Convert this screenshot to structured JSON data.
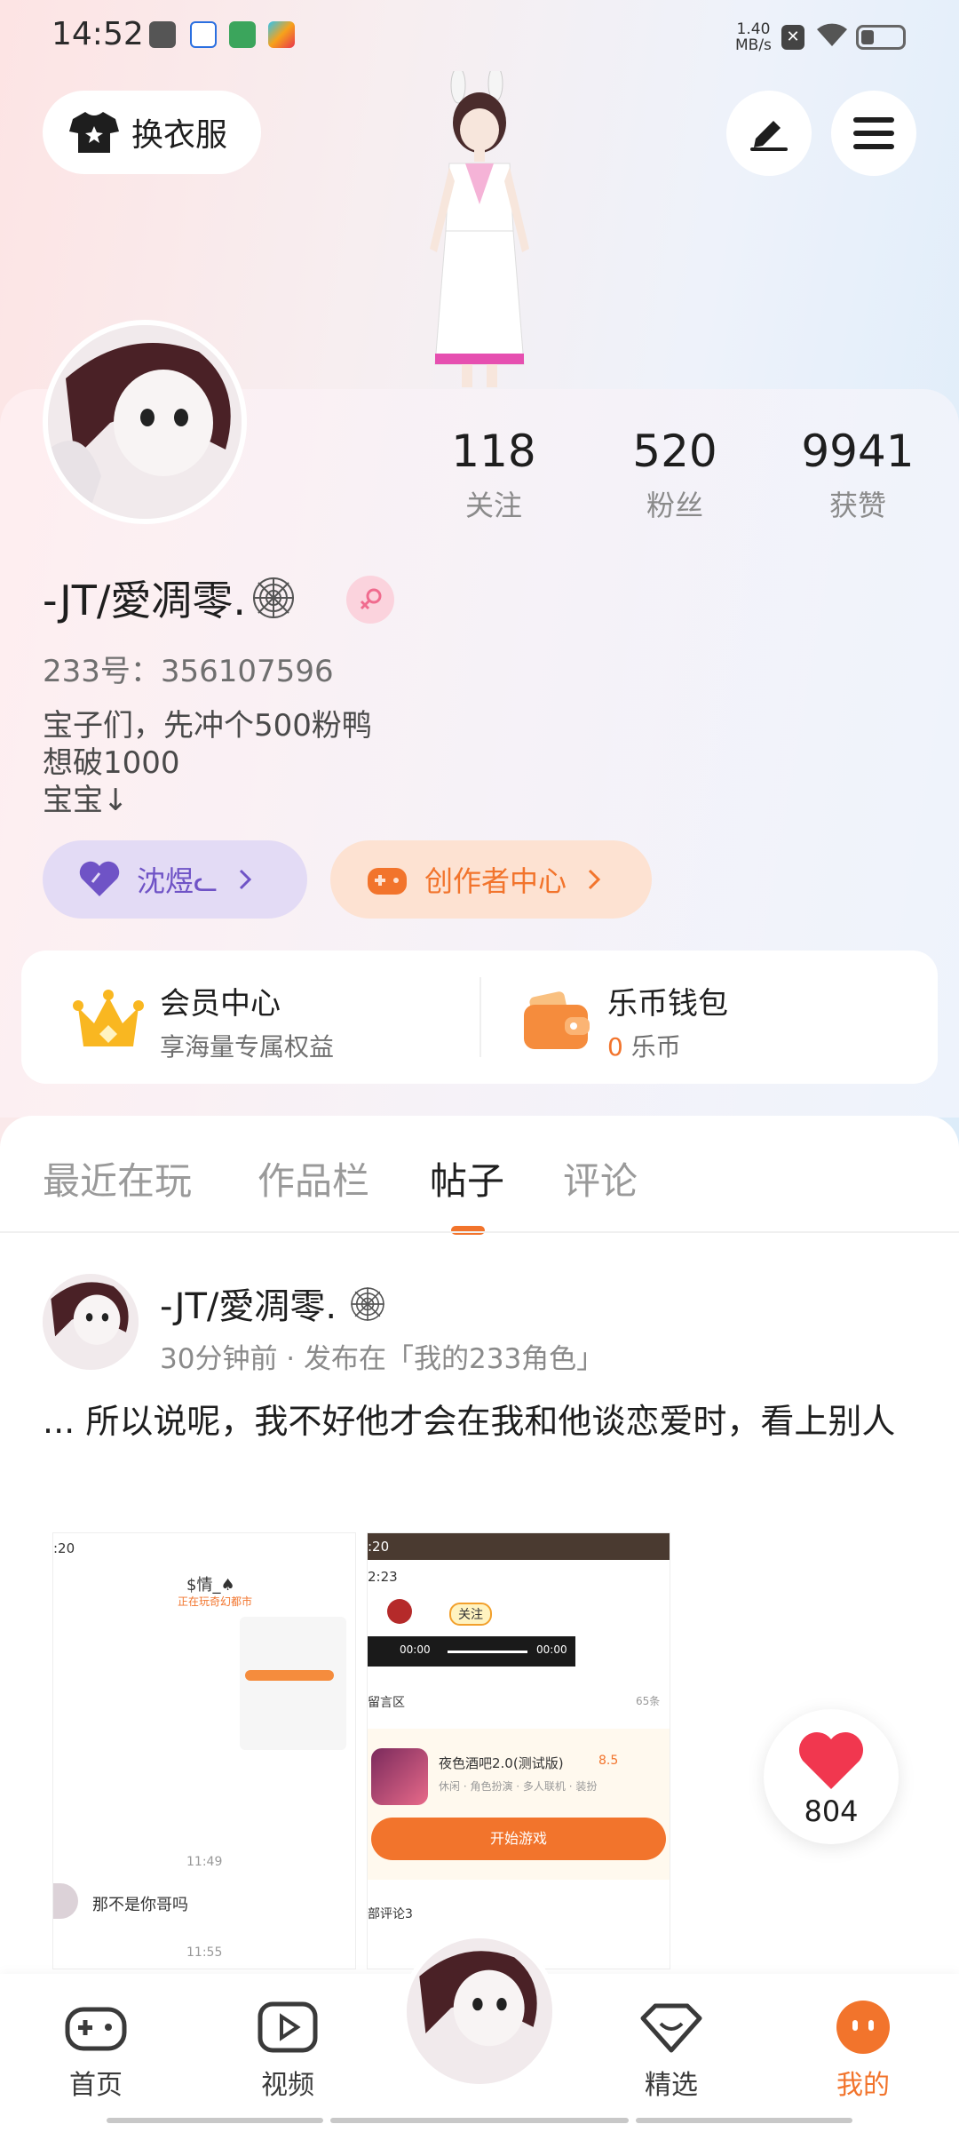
{
  "status_bar": {
    "time": "14:52",
    "speed_value": "1.40",
    "speed_unit": "MB/s"
  },
  "header": {
    "outfit_label": "换衣服"
  },
  "profile": {
    "stats": [
      {
        "num": "118",
        "label": "关注"
      },
      {
        "num": "520",
        "label": "粉丝"
      },
      {
        "num": "9941",
        "label": "获赞"
      }
    ],
    "username": "-JT/愛凋零.",
    "uid": "233号：356107596",
    "bio_lines": [
      "宝子们，先冲个500粉鸭",
      "想破1000",
      "宝宝↓"
    ],
    "pill_friend": "沈煜ᓚ",
    "pill_creator": "创作者中心"
  },
  "vip": {
    "member_title": "会员中心",
    "member_sub": "享海量专属权益",
    "wallet_title": "乐币钱包",
    "wallet_amount": "0",
    "wallet_unit": " 乐币"
  },
  "tabs": [
    "最近在玩",
    "作品栏",
    "帖子",
    "评论"
  ],
  "active_tab": "帖子",
  "post": {
    "author": "-JT/愛凋零.",
    "meta": "30分钟前 · 发布在「我的233角色」",
    "text": "...   所以说呢，我不好他才会在我和他谈恋爱时，看上别人",
    "shot1": {
      "time": ":20",
      "name": "$情_♠",
      "sub": "正在玩奇幻都市",
      "t1": "11:49",
      "msg": "那不是你哥吗",
      "t2": "11:55"
    },
    "shot2": {
      "time": ":20",
      "time2": "2:23",
      "follow": "关注",
      "audio_a": "00:00",
      "audio_b": "00:00",
      "section": "留言区",
      "count": "65条",
      "game_name": "夜色酒吧2.0(测试版)",
      "game_rating": "8.5",
      "game_tags": "休闲 · 角色扮演 · 多人联机 · 装扮",
      "play": "开始游戏",
      "comments": "部评论3"
    },
    "likes": "804"
  },
  "bottom_nav": [
    {
      "label": "首页",
      "icon": "gamepad-icon"
    },
    {
      "label": "视频",
      "icon": "video-play-icon"
    },
    {
      "label": "精选",
      "icon": "heart-diamond-icon"
    },
    {
      "label": "我的",
      "icon": "smile-face-icon"
    }
  ],
  "colors": {
    "accent": "#f2742c",
    "purple": "#6f53c6",
    "like": "#f1374f"
  }
}
